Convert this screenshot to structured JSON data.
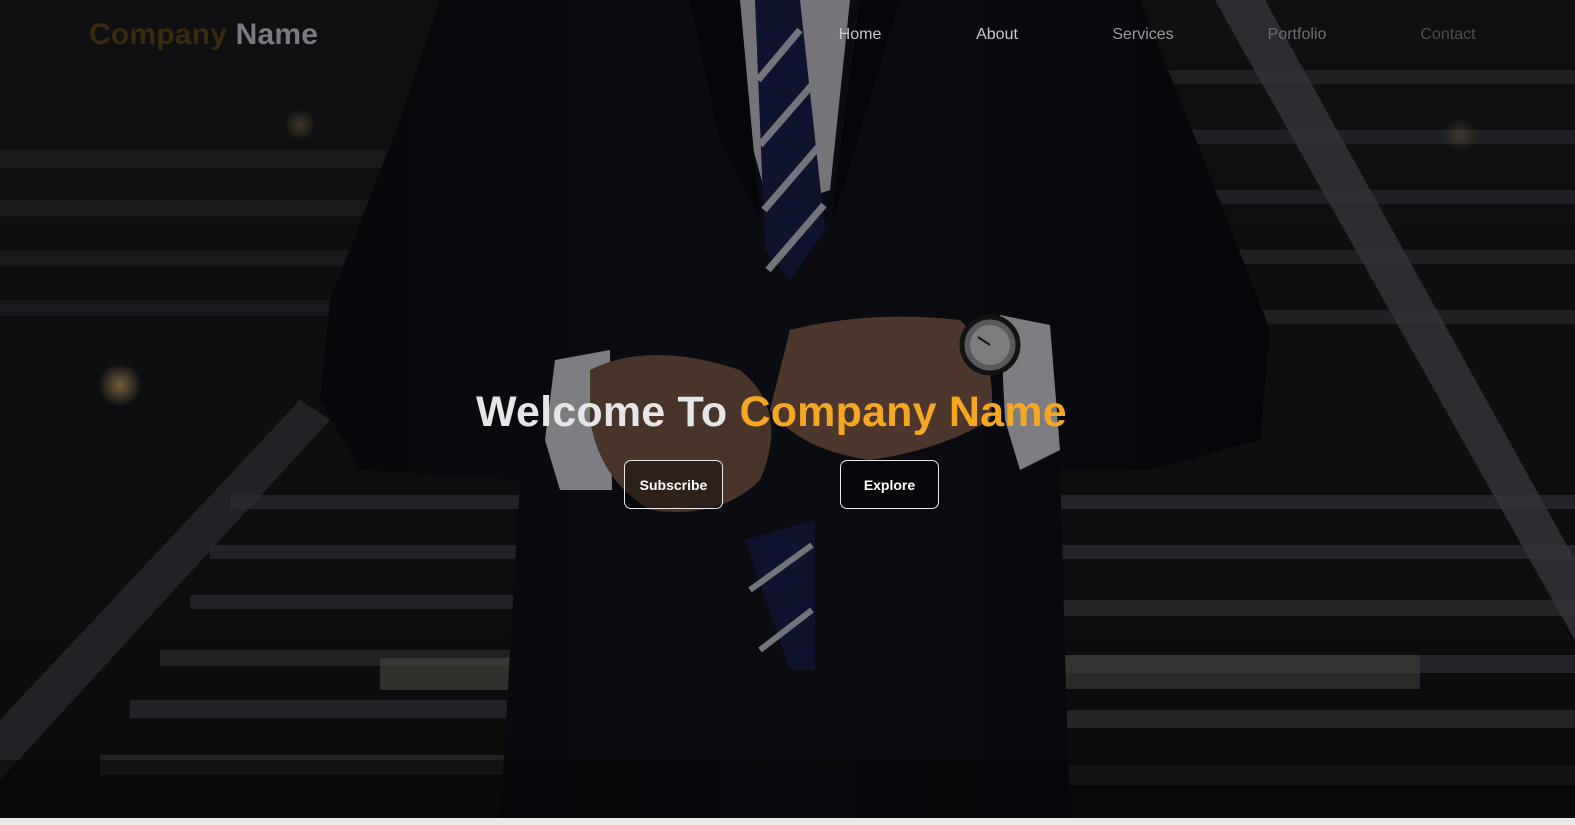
{
  "navbar": {
    "logo": {
      "part1": "Company",
      "part2": "Name"
    },
    "links": [
      {
        "label": "Home",
        "color": "#c9c9cd"
      },
      {
        "label": "About",
        "color": "#c9c9cd"
      },
      {
        "label": "Services",
        "color": "#9a9aa0"
      },
      {
        "label": "Portfolio",
        "color": "#6f6f76"
      },
      {
        "label": "Contact",
        "color": "#4c4c52"
      }
    ]
  },
  "hero": {
    "title_part1": "Welcome To",
    "title_part2": "Company Name",
    "subscribe_label": "Subscribe",
    "explore_label": "Explore",
    "background_image": "businessman-in-suit-buttoning-jacket-on-stairs"
  },
  "colors": {
    "accent": "#f5a623",
    "title_white": "#e6e6e8"
  }
}
